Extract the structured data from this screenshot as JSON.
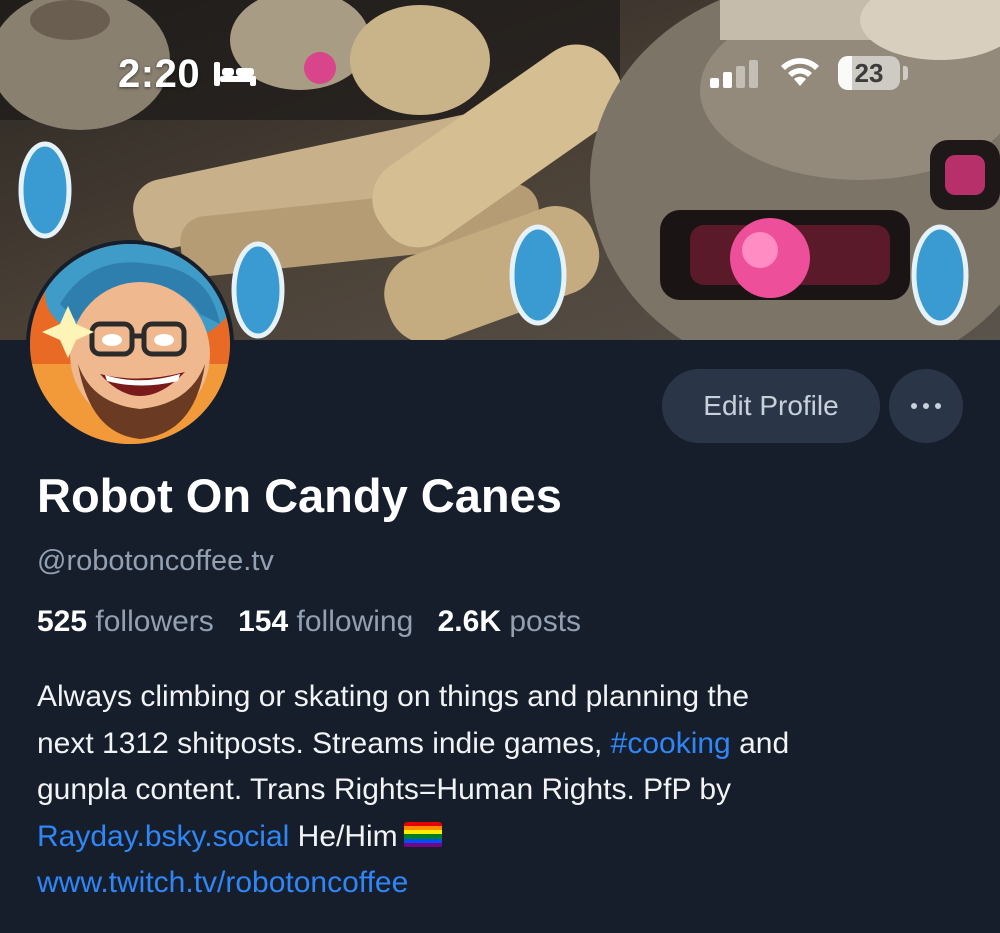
{
  "status_bar": {
    "time": "2:20",
    "sleep_icon": "bed-icon",
    "signal_icon": "cellular-signal-icon",
    "wifi_icon": "wifi-icon",
    "battery_percent": "23",
    "battery_level": 0.23
  },
  "profile": {
    "display_name": "Robot On Candy Canes",
    "handle": "@robotoncoffee.tv",
    "followers_count": "525",
    "followers_label": "followers",
    "following_count": "154",
    "following_label": "following",
    "posts_count": "2.6K",
    "posts_label": "posts"
  },
  "actions": {
    "edit_profile_label": "Edit Profile",
    "more_icon": "ellipsis-icon"
  },
  "bio": {
    "line1": "Always climbing or skating on things and planning the",
    "line2_pre": "next 1312 shitposts. Streams indie games, ",
    "hashtag": "#cooking",
    "line2_post": " and",
    "line3": "gunpla content. Trans Rights=Human Rights. PfP by",
    "mention": "Rayday.bsky.social",
    "line4_post": " He/Him",
    "flag_icon": "rainbow-flag-icon",
    "website": "www.twitch.tv/robotoncoffee"
  },
  "colors": {
    "background": "#161e2b",
    "button_bg": "#2a3648",
    "link": "#2f86f6",
    "muted_text": "#93a0b2"
  }
}
